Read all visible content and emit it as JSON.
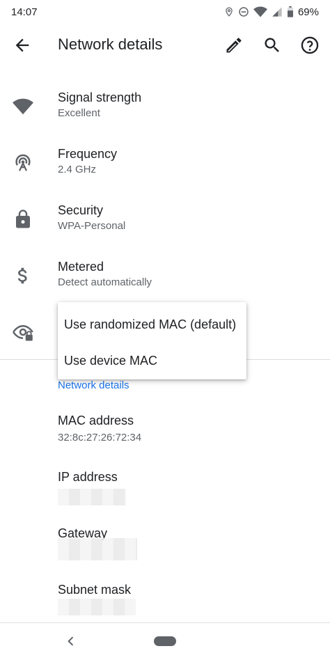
{
  "status_bar": {
    "time": "14:07",
    "battery": "69%",
    "icons": [
      "location-icon",
      "dnd-icon",
      "wifi-icon",
      "signal-icon",
      "battery-icon"
    ]
  },
  "app_bar": {
    "title": "Network details",
    "actions": [
      "edit-icon",
      "search-icon",
      "help-icon"
    ]
  },
  "rows": [
    {
      "title": "Signal strength",
      "subtitle": "Excellent",
      "icon": "wifi-signal-icon"
    },
    {
      "title": "Frequency",
      "subtitle": "2.4 GHz",
      "icon": "frequency-icon"
    },
    {
      "title": "Security",
      "subtitle": "WPA-Personal",
      "icon": "lock-icon"
    },
    {
      "title": "Metered",
      "subtitle": "Detect automatically",
      "icon": "dollar-icon"
    },
    {
      "title": "",
      "subtitle": "",
      "icon": "privacy-eye-icon"
    }
  ],
  "popup": {
    "options": [
      "Use randomized MAC (default)",
      "Use device MAC"
    ]
  },
  "section_header": "Network details",
  "details": [
    {
      "title": "MAC address",
      "value": "32:8c:27:26:72:34"
    },
    {
      "title": "IP address",
      "value": ""
    },
    {
      "title": "Gateway",
      "value": ""
    },
    {
      "title": "Subnet mask",
      "value": ""
    }
  ],
  "colors": {
    "accent": "#1a73e8",
    "icon_grey": "#5f6368",
    "text_primary": "#202124"
  }
}
